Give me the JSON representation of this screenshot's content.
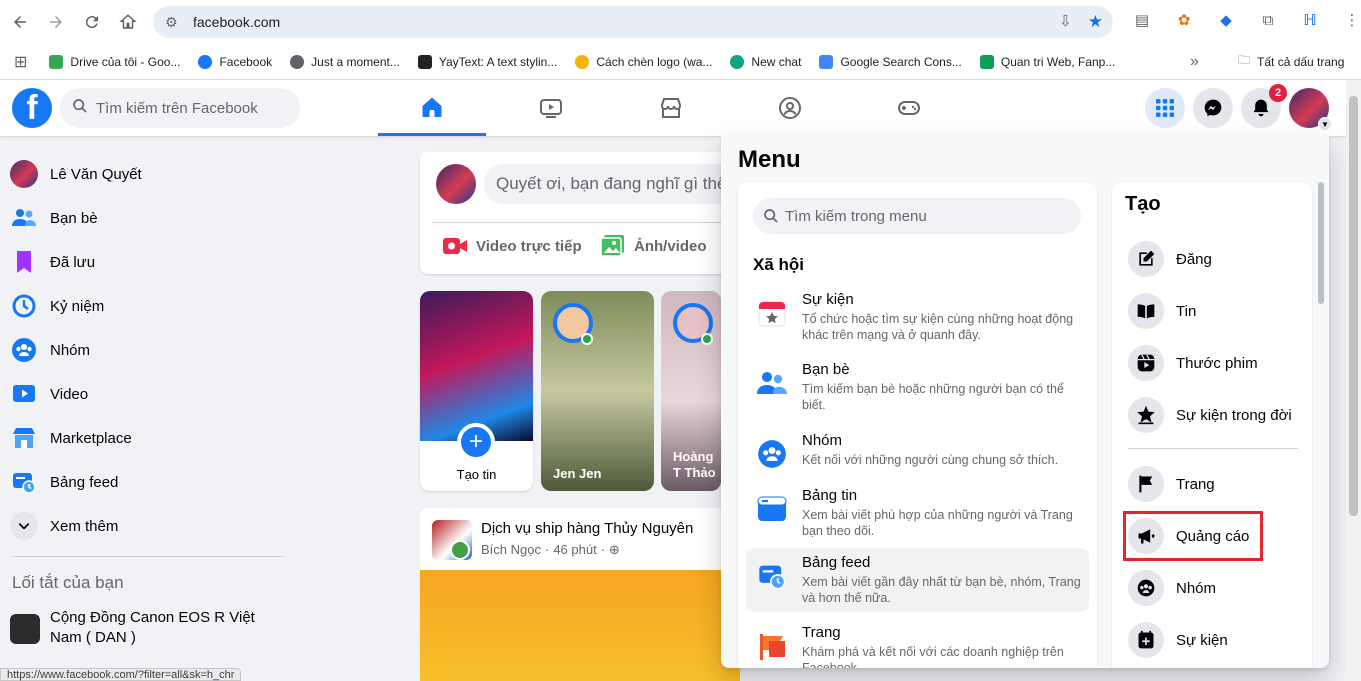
{
  "browser": {
    "url": "facebook.com",
    "bookmarks": [
      {
        "label": "Drive của tôi - Goo...",
        "color": "#34a853"
      },
      {
        "label": "Facebook",
        "color": "#1877f2"
      },
      {
        "label": "Just a moment...",
        "color": "#5f6368"
      },
      {
        "label": "YayText: A text stylin...",
        "color": "#222222"
      },
      {
        "label": "Cách chèn logo (wa...",
        "color": "#f4b400"
      },
      {
        "label": "New chat",
        "color": "#10a37f"
      },
      {
        "label": "Google Search Cons...",
        "color": "#4285f4"
      },
      {
        "label": "Quan tri Web, Fanp...",
        "color": "#0f9d58"
      }
    ],
    "more_bookmarks": "»",
    "all_bookmarks": "Tất cả dấu trang",
    "status_url": "https://www.facebook.com/?filter=all&sk=h_chr"
  },
  "header": {
    "search_placeholder": "Tìm kiếm trên Facebook",
    "notification_count": "2"
  },
  "sidebar": {
    "items": [
      {
        "label": "Lê Văn Quyết",
        "icon": "profile-avatar"
      },
      {
        "label": "Bạn bè",
        "icon": "friends-icon"
      },
      {
        "label": "Đã lưu",
        "icon": "saved-icon"
      },
      {
        "label": "Kỷ niệm",
        "icon": "memories-icon"
      },
      {
        "label": "Nhóm",
        "icon": "groups-icon"
      },
      {
        "label": "Video",
        "icon": "video-icon"
      },
      {
        "label": "Marketplace",
        "icon": "marketplace-icon"
      },
      {
        "label": "Bảng feed",
        "icon": "feeds-icon"
      },
      {
        "label": "Xem thêm",
        "icon": "chevron-down-icon"
      }
    ],
    "shortcuts_title": "Lối tắt của bạn",
    "shortcut": "Cộng Đồng Canon EOS R Việt Nam ( DAN )"
  },
  "composer": {
    "placeholder": "Quyết ơi, bạn đang nghĩ gì thế?",
    "live_video": "Video trực tiếp",
    "photo_video": "Ảnh/video"
  },
  "stories": {
    "create": "Tạo tin",
    "story1": "Jen Jen",
    "story2": "Hoàng T Thảo"
  },
  "post": {
    "page_name": "Dịch vụ ship hàng Thủy Nguyên",
    "author": "Bích Ngọc",
    "time": "46 phút",
    "separator": "·"
  },
  "menu": {
    "title": "Menu",
    "search_placeholder": "Tìm kiếm trong menu",
    "social_title": "Xã hội",
    "items": [
      {
        "title": "Sự kiện",
        "desc": "Tổ chức hoặc tìm sự kiện cùng những hoạt động khác trên mạng và ở quanh đây."
      },
      {
        "title": "Bạn bè",
        "desc": "Tìm kiếm bạn bè hoặc những người bạn có thể biết."
      },
      {
        "title": "Nhóm",
        "desc": "Kết nối với những người cùng chung sở thích."
      },
      {
        "title": "Bảng tin",
        "desc": "Xem bài viết phù hợp của những người và Trang bạn theo dõi."
      },
      {
        "title": "Bảng feed",
        "desc": "Xem bài viết gần đây nhất từ bạn bè, nhóm, Trang và hơn thế nữa."
      },
      {
        "title": "Trang",
        "desc": "Khám phá và kết nối với các doanh nghiệp trên Facebook."
      }
    ],
    "create_title": "Tạo",
    "create_items": [
      {
        "label": "Đăng",
        "icon": "edit-icon"
      },
      {
        "label": "Tin",
        "icon": "book-icon"
      },
      {
        "label": "Thước phim",
        "icon": "reel-icon"
      },
      {
        "label": "Sự kiện trong đời",
        "icon": "star-icon"
      },
      {
        "label": "Trang",
        "icon": "flag-icon"
      },
      {
        "label": "Quảng cáo",
        "icon": "megaphone-icon"
      },
      {
        "label": "Nhóm",
        "icon": "group-icon"
      },
      {
        "label": "Sự kiện",
        "icon": "calendar-plus-icon"
      }
    ]
  }
}
